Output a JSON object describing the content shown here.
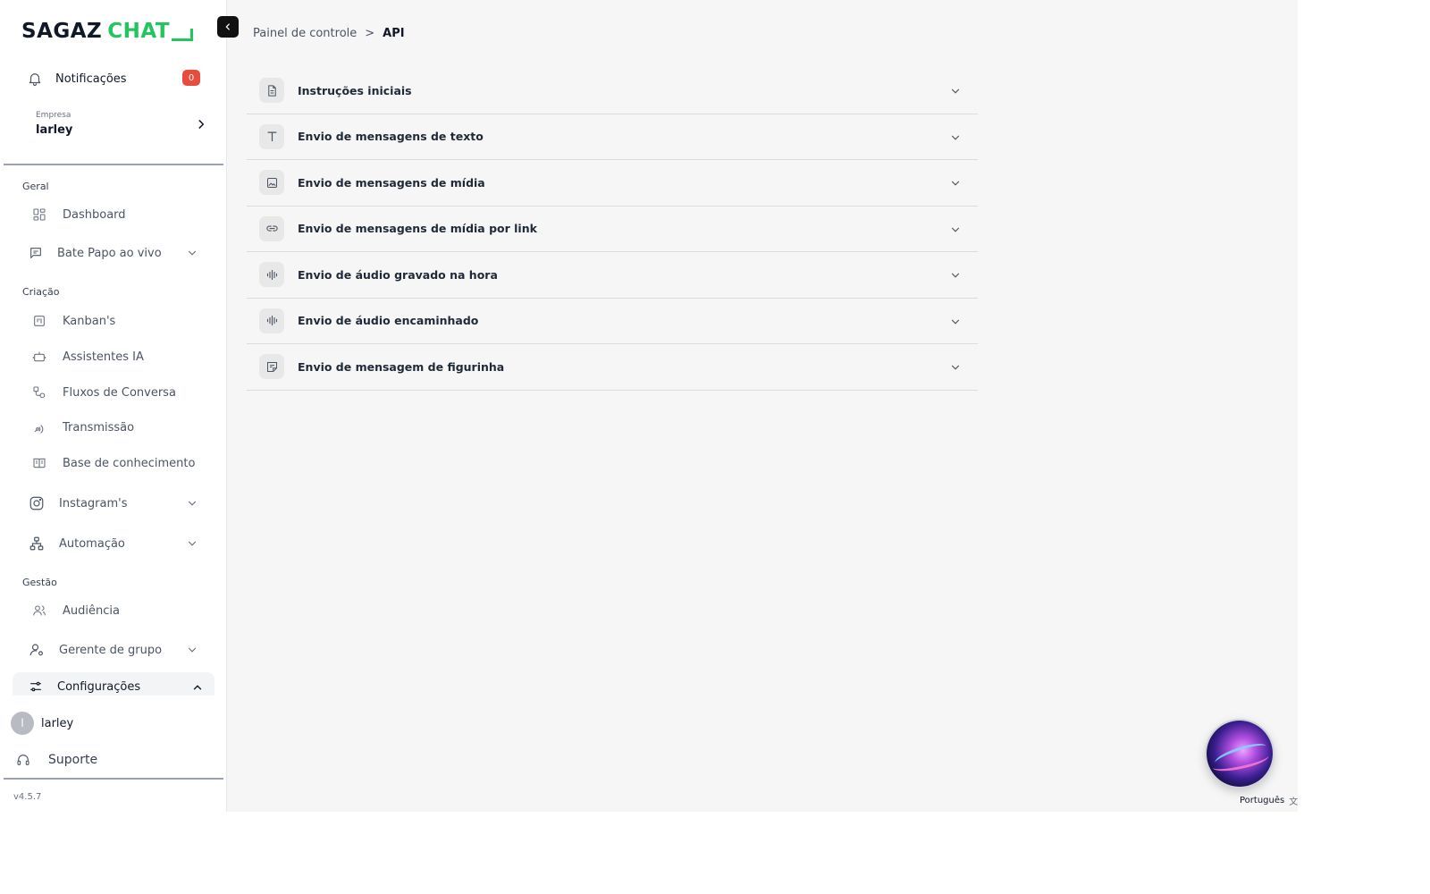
{
  "brand": {
    "word1": "SAGAZ",
    "word2": "CHAT",
    "accent_color": "#22c55e"
  },
  "notifications": {
    "label": "Notificações",
    "count": "0"
  },
  "company": {
    "label": "Empresa",
    "name": "larley"
  },
  "sections": {
    "geral": "Geral",
    "criacao": "Criação",
    "gestao": "Gestão"
  },
  "nav": {
    "dashboard": "Dashboard",
    "bate_papo": "Bate Papo ao vivo",
    "kanbans": "Kanban's",
    "assistentes": "Assistentes IA",
    "fluxos": "Fluxos de Conversa",
    "transmissao": "Transmissão",
    "base": "Base de conhecimento",
    "instagram": "Instagram's",
    "automacao": "Automação",
    "audiencia": "Audiência",
    "gerente": "Gerente de grupo",
    "configuracoes": "Configurações"
  },
  "user": {
    "initial": "l",
    "name": "larley"
  },
  "support": {
    "label": "Suporte"
  },
  "version": "v4.5.7",
  "breadcrumb": {
    "root": "Painel de controle",
    "separator": ">",
    "current": "API"
  },
  "accordion": [
    {
      "title": "Instruções iniciais",
      "icon": "document-icon"
    },
    {
      "title": "Envio de mensagens de texto",
      "icon": "text-icon"
    },
    {
      "title": "Envio de mensagens de mídia",
      "icon": "image-icon"
    },
    {
      "title": "Envio de mensagens de mídia por link",
      "icon": "link-icon"
    },
    {
      "title": "Envio de áudio gravado na hora",
      "icon": "audio-icon"
    },
    {
      "title": "Envio de áudio encaminhado",
      "icon": "audio-icon"
    },
    {
      "title": "Envio de mensagem de figurinha",
      "icon": "sticker-icon"
    }
  ],
  "language": {
    "label": "Português"
  }
}
